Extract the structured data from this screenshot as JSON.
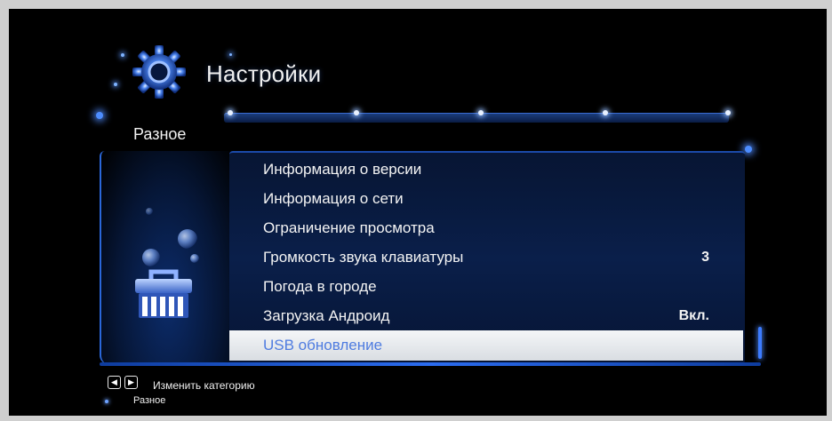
{
  "header": {
    "title": "Настройки",
    "icon": "gear-icon",
    "accent_color": "#3c7bff"
  },
  "category_bar": {
    "current_category": "Разное"
  },
  "menu": {
    "items": [
      {
        "label": "Информация о версии",
        "value": ""
      },
      {
        "label": "Информация о сети",
        "value": ""
      },
      {
        "label": "Ограничение просмотра",
        "value": ""
      },
      {
        "label": "Громкость звука клавиатуры",
        "value": "3"
      },
      {
        "label": "Погода в городе",
        "value": ""
      },
      {
        "label": "Загрузка Андроид",
        "value": "Вкл."
      },
      {
        "label": "USB обновление",
        "value": ""
      }
    ],
    "selected_index": 6,
    "selected_text_color": "#4f7ce0"
  },
  "left_panel": {
    "icon": "toolbox-icon"
  },
  "footer": {
    "left_button_icon": "arrow-left-icon",
    "right_button_icon": "arrow-right-icon",
    "hint": "Изменить категорию",
    "current": "Разное"
  }
}
